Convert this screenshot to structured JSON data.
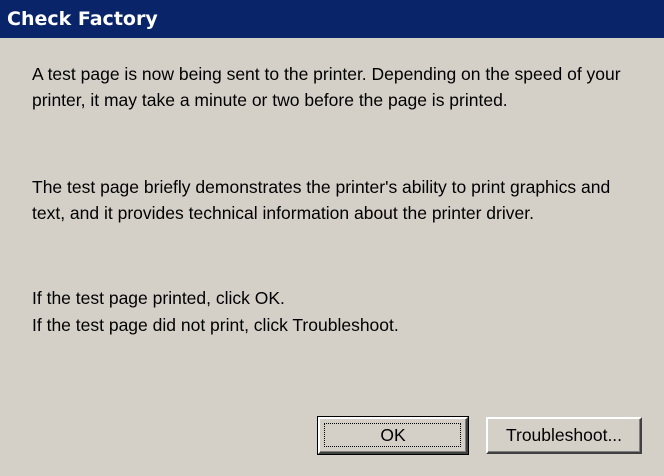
{
  "window": {
    "title": "Check Factory"
  },
  "message": {
    "paragraph1": "A test page is now being sent to the printer. Depending on the speed of your printer, it may take a minute or two before the page is printed.",
    "paragraph2": "The test page briefly demonstrates the printer's ability to print graphics and text, and it provides technical information about the printer driver.",
    "line_ok": "If the test page printed, click OK.",
    "line_trouble": "If the test page did not print, click Troubleshoot."
  },
  "buttons": {
    "ok_label": "OK",
    "troubleshoot_label": "Troubleshoot..."
  },
  "colors": {
    "titlebar_bg": "#0a246a",
    "window_bg": "#d4d0c8",
    "title_text": "#ffffff",
    "body_text": "#000000"
  }
}
